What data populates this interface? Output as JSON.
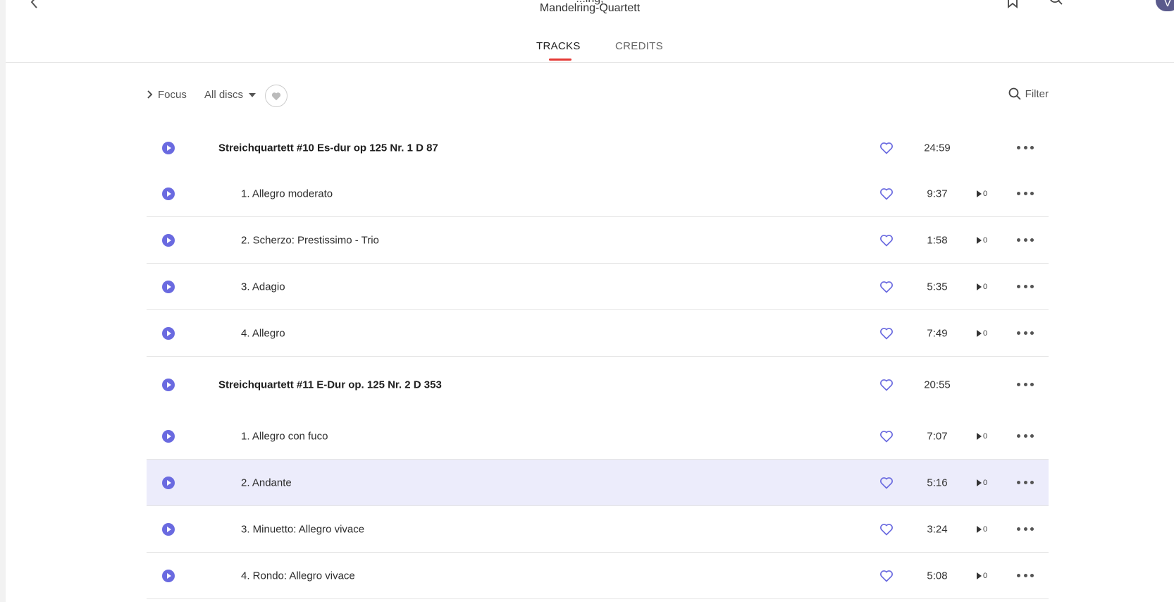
{
  "header": {
    "title_line1": "...ing,",
    "title_line2": "Mandelring-Quartett",
    "avatar_letter": "V"
  },
  "tabs": [
    {
      "label": "TRACKS",
      "active": true
    },
    {
      "label": "CREDITS",
      "active": false
    }
  ],
  "toolbar": {
    "focus_label": "Focus",
    "discs_label": "All discs",
    "filter_label": "Filter"
  },
  "colors": {
    "accent": "#6a6ae0",
    "tab_underline": "#e53935",
    "highlight_row": "#ececfb"
  },
  "works": [
    {
      "title": "Streichquartett #10 Es-dur op 125 Nr. 1 D 87",
      "duration": "24:59",
      "tracks": [
        {
          "title": "1. Allegro moderato",
          "duration": "9:37",
          "plays": "0"
        },
        {
          "title": "2. Scherzo: Prestissimo - Trio",
          "duration": "1:58",
          "plays": "0"
        },
        {
          "title": "3. Adagio",
          "duration": "5:35",
          "plays": "0"
        },
        {
          "title": "4. Allegro",
          "duration": "7:49",
          "plays": "0"
        }
      ]
    },
    {
      "title": "Streichquartett #11 E-Dur op. 125 Nr. 2 D 353",
      "duration": "20:55",
      "tracks": [
        {
          "title": "1. Allegro con fuco",
          "duration": "7:07",
          "plays": "0"
        },
        {
          "title": "2. Andante",
          "duration": "5:16",
          "plays": "0",
          "highlighted": true
        },
        {
          "title": "3. Minuetto: Allegro vivace",
          "duration": "3:24",
          "plays": "0"
        },
        {
          "title": "4. Rondo: Allegro vivace",
          "duration": "5:08",
          "plays": "0"
        }
      ]
    }
  ]
}
